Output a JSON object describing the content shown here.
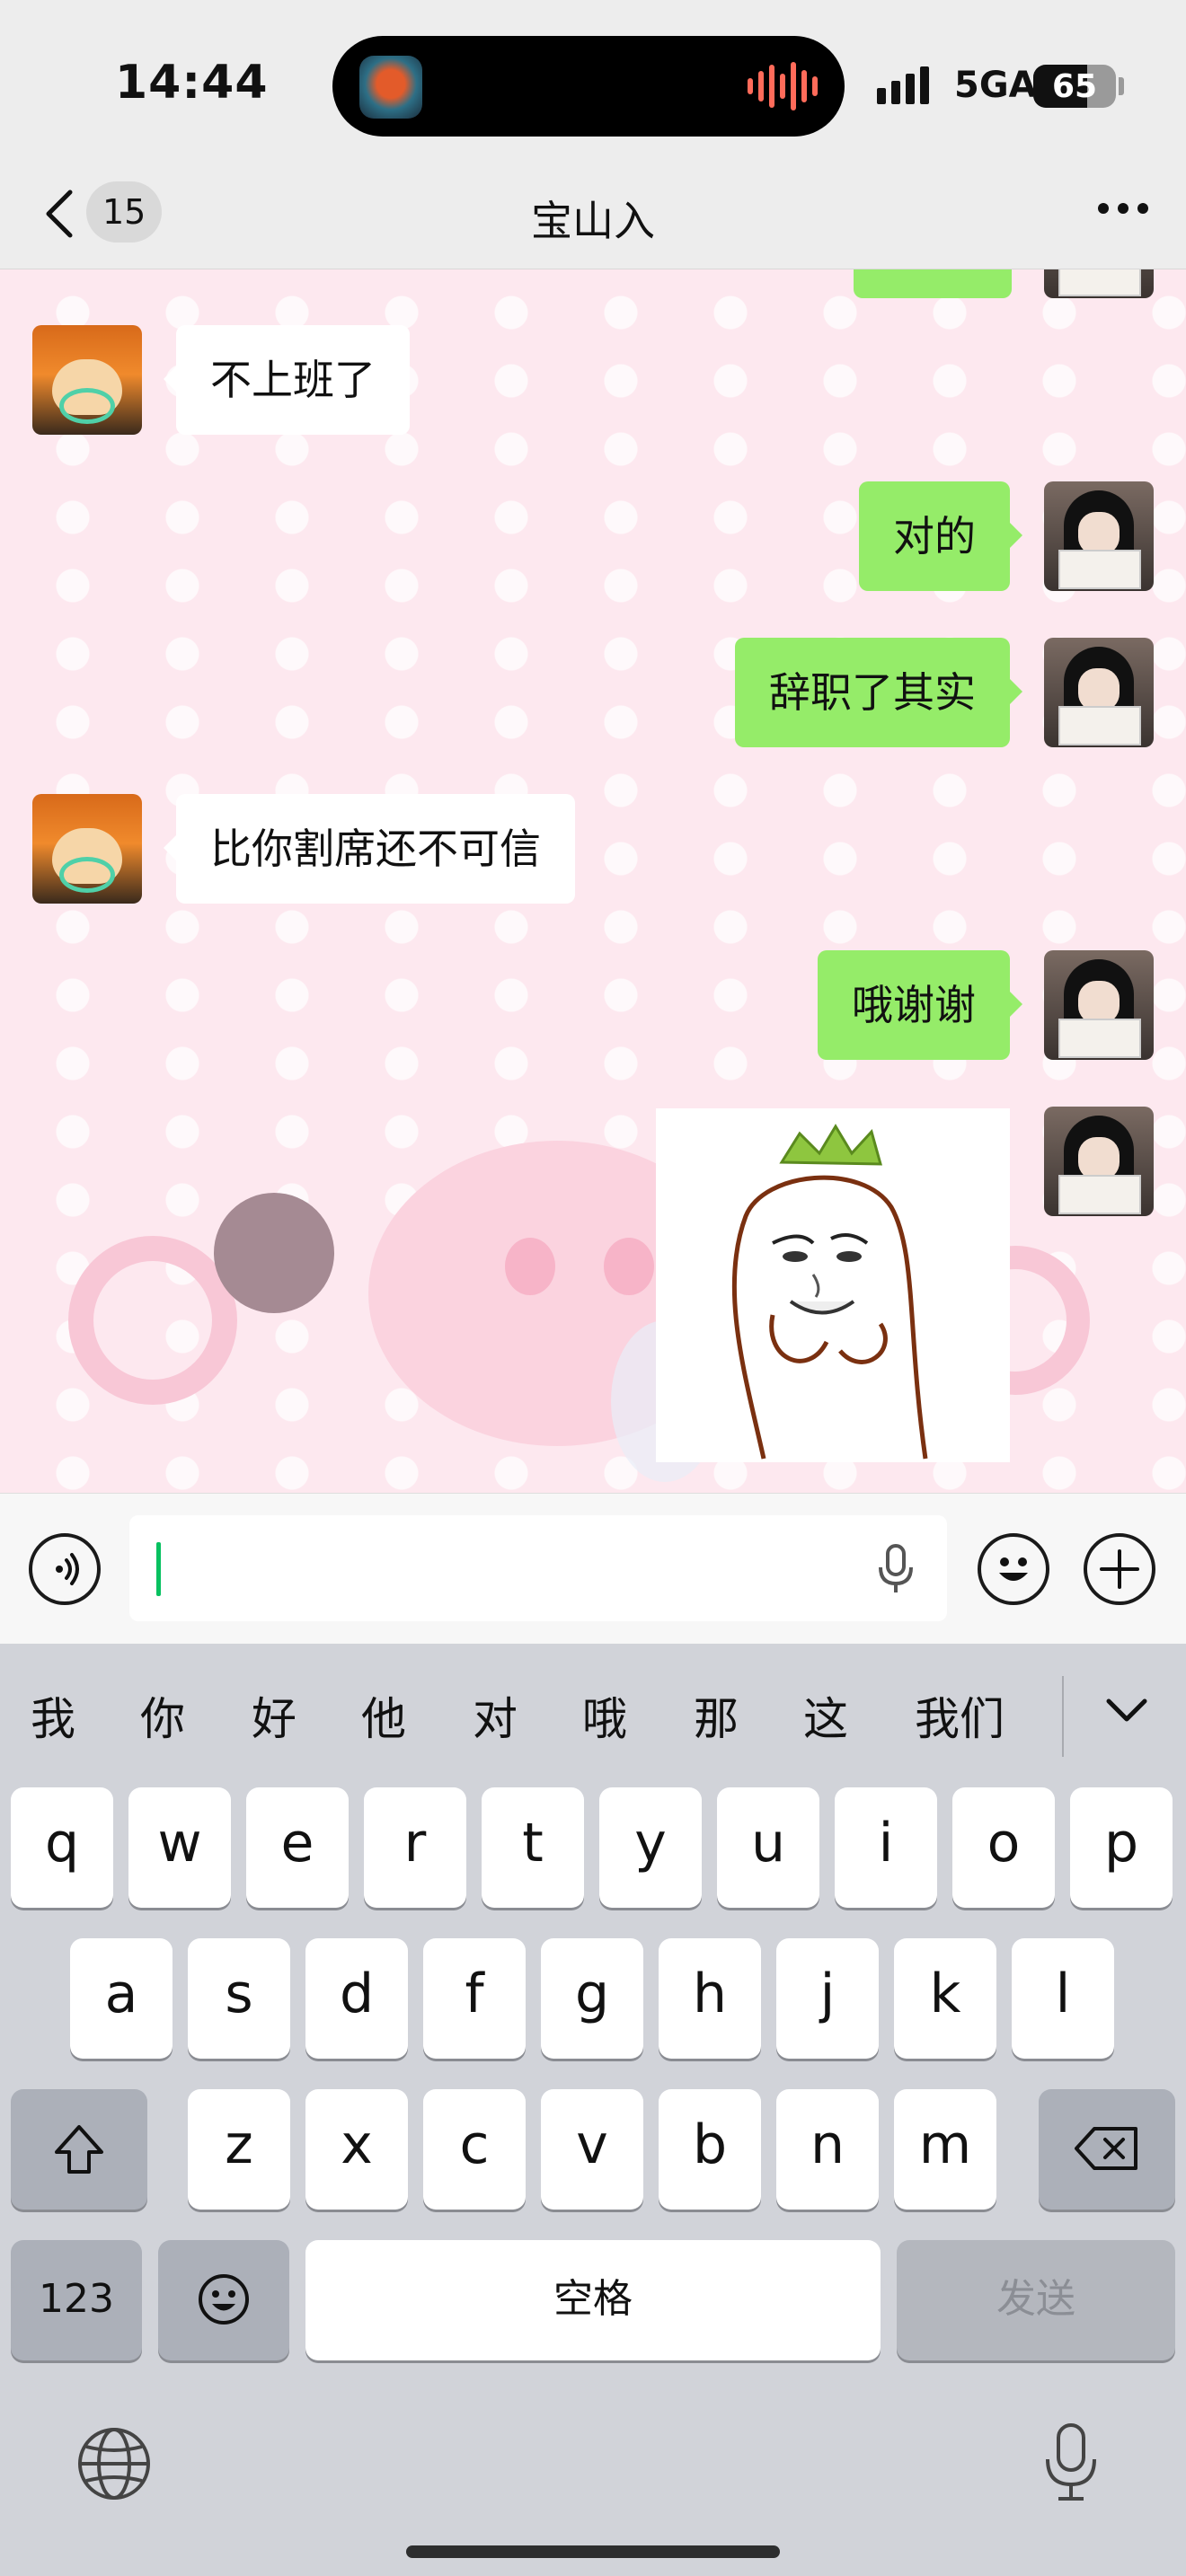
{
  "status_bar": {
    "time": "14:44",
    "network": "5GA",
    "battery": "65",
    "battery_level_percent": 65
  },
  "nav": {
    "back_icon": "chevron-left-icon",
    "unread_badge": "15",
    "title": "宝山入",
    "more_icon": "ellipsis-icon"
  },
  "messages": [
    {
      "side": "left",
      "text": "不上班了"
    },
    {
      "side": "right",
      "text": "对的"
    },
    {
      "side": "right",
      "text": "辞职了其实"
    },
    {
      "side": "left",
      "text": "比你割席还不可信"
    },
    {
      "side": "right",
      "text": "哦谢谢"
    },
    {
      "side": "right",
      "type": "sticker",
      "icon": "crowned-meme-face-sticker"
    }
  ],
  "input_bar": {
    "voice_icon": "voice-mode-icon",
    "mic_icon": "microphone-icon",
    "emoji_icon": "smiley-icon",
    "plus_icon": "plus-icon",
    "value": ""
  },
  "keyboard": {
    "candidates": [
      "我",
      "你",
      "好",
      "他",
      "对",
      "哦",
      "那",
      "这",
      "我们"
    ],
    "collapse_icon": "chevron-down-icon",
    "row1": [
      "q",
      "w",
      "e",
      "r",
      "t",
      "y",
      "u",
      "i",
      "o",
      "p"
    ],
    "row2": [
      "a",
      "s",
      "d",
      "f",
      "g",
      "h",
      "j",
      "k",
      "l"
    ],
    "row3": [
      "z",
      "x",
      "c",
      "v",
      "b",
      "n",
      "m"
    ],
    "shift_icon": "shift-icon",
    "backspace_icon": "backspace-icon",
    "numbers_label": "123",
    "emoji_key_icon": "emoji-key-icon",
    "space_label": "空格",
    "send_label": "发送",
    "globe_icon": "globe-icon",
    "dictation_icon": "dictation-mic-icon"
  },
  "colors": {
    "sent_bubble": "#95ec69",
    "received_bubble": "#ffffff",
    "chat_background": "#fde8ef",
    "caret": "#07c160"
  }
}
